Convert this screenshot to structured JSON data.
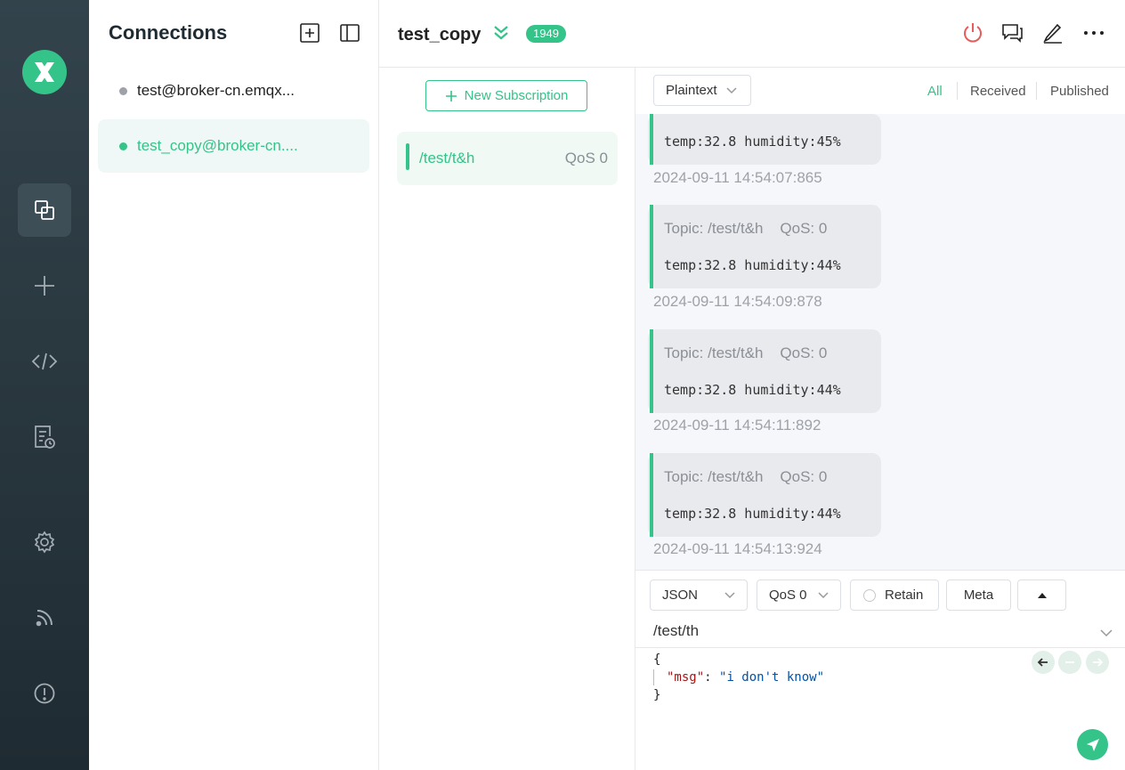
{
  "app": {
    "name": "MQTTX"
  },
  "sidebar": {
    "icons": [
      "logo-icon",
      "connections-icon",
      "new-connection-icon",
      "script-icon",
      "log-icon",
      "settings-icon",
      "subscription-feed-icon",
      "about-icon"
    ]
  },
  "connections": {
    "title": "Connections",
    "items": [
      {
        "label": "test@broker-cn.emqx...",
        "status": "disconnected",
        "status_color": "#9ea2a8"
      },
      {
        "label": "test_copy@broker-cn....",
        "status": "connected",
        "status_color": "#34c388"
      }
    ]
  },
  "header": {
    "title": "test_copy",
    "badge": "1949"
  },
  "subscriptions": {
    "new_label": "New Subscription",
    "items": [
      {
        "topic": "/test/t&h",
        "qos": "QoS 0",
        "color": "#34c388"
      }
    ]
  },
  "messages": {
    "format": "Plaintext",
    "filters": [
      "All",
      "Received",
      "Published"
    ],
    "active_filter": "All",
    "items": [
      {
        "topic": "",
        "payload": "temp:32.8 humidity:45%",
        "time": "2024-09-11 14:54:07:865"
      },
      {
        "topic": "Topic: /test/t&h    QoS: 0",
        "payload": "temp:32.8 humidity:44%",
        "time": "2024-09-11 14:54:09:878"
      },
      {
        "topic": "Topic: /test/t&h    QoS: 0",
        "payload": "temp:32.8 humidity:44%",
        "time": "2024-09-11 14:54:11:892"
      },
      {
        "topic": "Topic: /test/t&h    QoS: 0",
        "payload": "temp:32.8 humidity:44%",
        "time": "2024-09-11 14:54:13:924"
      }
    ]
  },
  "publish": {
    "payload_format": "JSON",
    "qos": "QoS 0",
    "retain_label": "Retain",
    "meta_label": "Meta",
    "topic": "/test/th",
    "payload_lines": [
      "{",
      "\"msg\"",
      ": ",
      "\"i don't know\"",
      "}"
    ]
  },
  "colors": {
    "accent": "#34c388",
    "rail": "#2b3941",
    "danger": "#e65c5c"
  }
}
